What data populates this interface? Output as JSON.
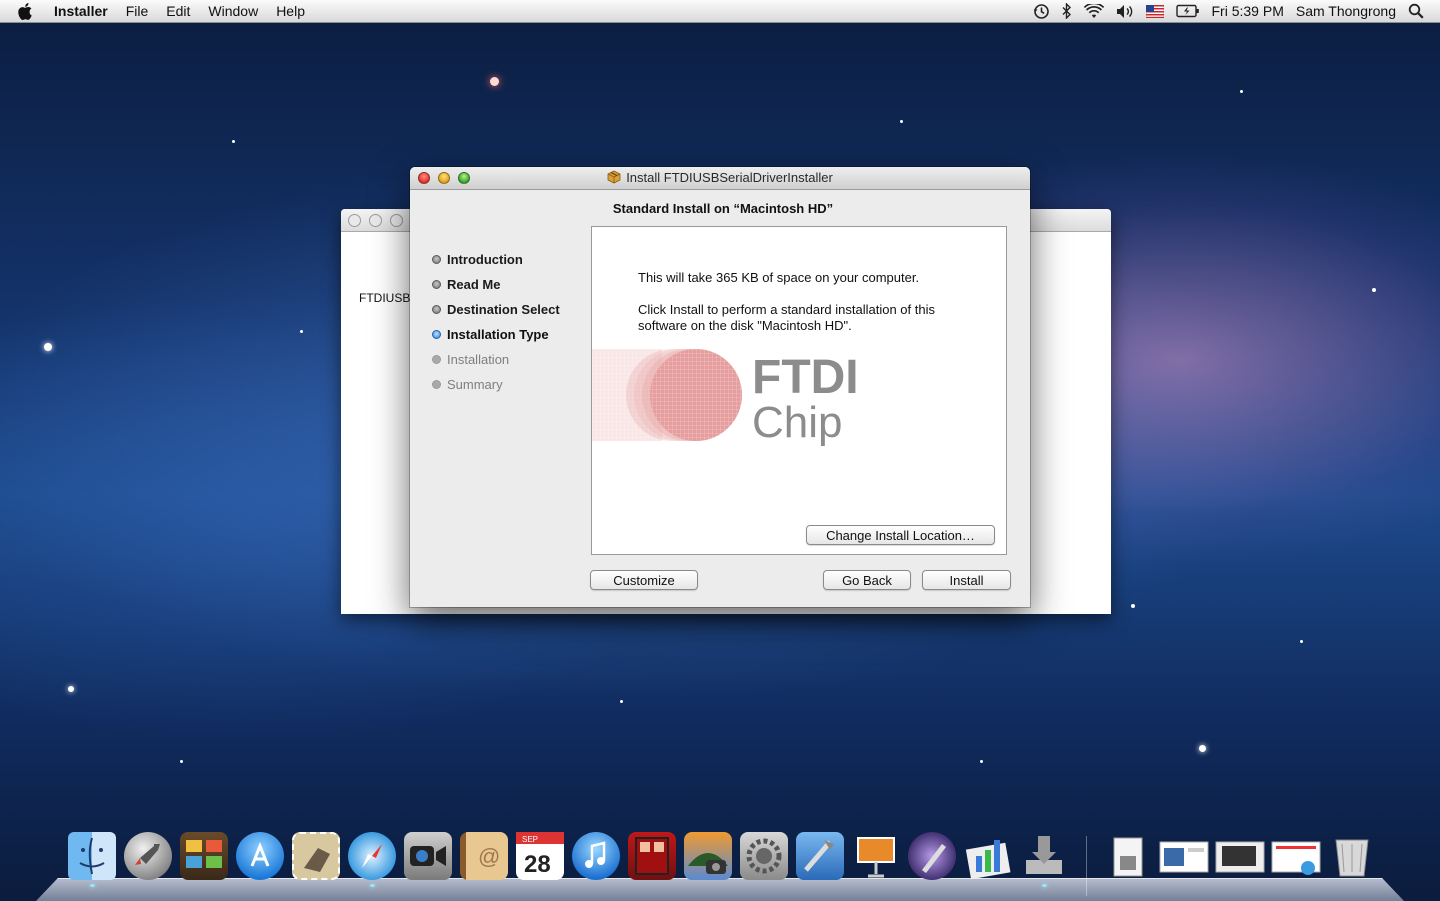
{
  "menubar": {
    "app_name": "Installer",
    "menus": [
      "File",
      "Edit",
      "Window",
      "Help"
    ],
    "clock": "Fri 5:39 PM",
    "user": "Sam Thongrong"
  },
  "background_window": {
    "label": "FTDIUSBS"
  },
  "window": {
    "title": "Install FTDIUSBSerialDriverInstaller",
    "heading": "Standard Install on “Macintosh HD”",
    "steps": [
      {
        "label": "Introduction",
        "state": "done"
      },
      {
        "label": "Read Me",
        "state": "done"
      },
      {
        "label": "Destination Select",
        "state": "done"
      },
      {
        "label": "Installation Type",
        "state": "active"
      },
      {
        "label": "Installation",
        "state": "pending"
      },
      {
        "label": "Summary",
        "state": "pending"
      }
    ],
    "content": {
      "space_text": "This will take 365 KB of space on your computer.",
      "instruction_text": "Click Install to perform a standard installation of this software on the disk \"Macintosh HD\".",
      "logo_line1": "FTDI",
      "logo_line2": "Chip",
      "change_location_button": "Change Install Location…"
    },
    "buttons": {
      "customize": "Customize",
      "go_back": "Go Back",
      "install": "Install"
    }
  },
  "dock": {
    "apps": [
      "finder-icon",
      "launchpad-icon",
      "photo-booth-icon",
      "app-store-icon",
      "mail-stamp-icon",
      "safari-icon",
      "facetime-icon",
      "contacts-icon",
      "calendar-icon",
      "itunes-icon",
      "photo-strip-icon",
      "iphoto-icon",
      "system-preferences-icon",
      "xcode-icon",
      "keynote-icon",
      "pen-app-icon",
      "numbers-icon",
      "installer-icon",
      "document-icon",
      "preview-window-icon",
      "screen-window-icon",
      "web-window-icon",
      "trash-icon"
    ],
    "calendar_month": "SEP",
    "calendar_day": "28"
  }
}
